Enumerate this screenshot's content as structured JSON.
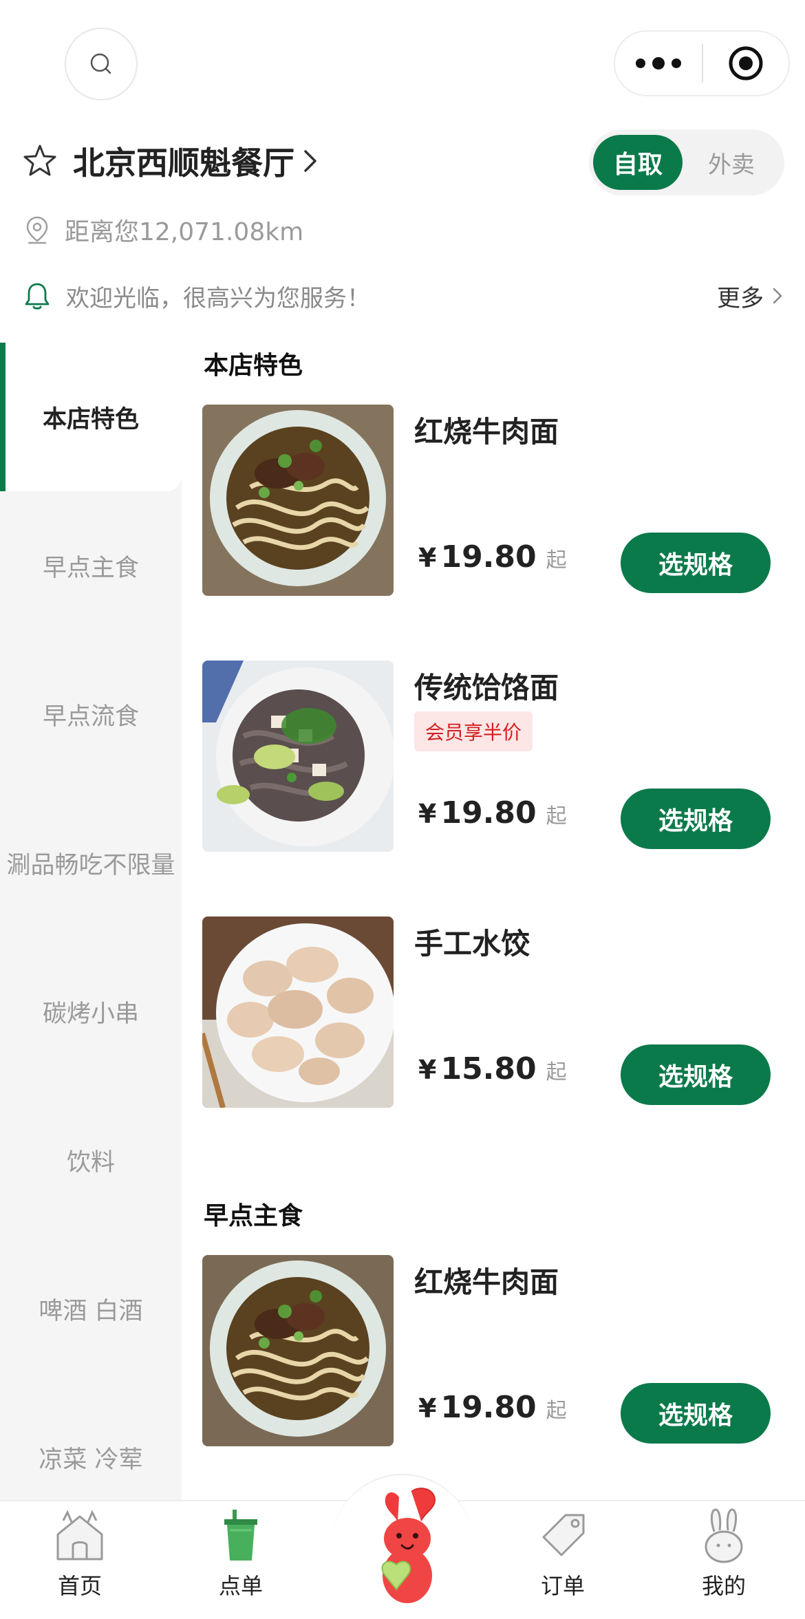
{
  "topbar": {
    "search_icon": "search-icon",
    "more_icon": "more-dots-icon",
    "close_icon": "record-target-icon"
  },
  "store": {
    "name": "北京西顺魁餐厅",
    "distance": "距离您12,071.08km",
    "notice": "欢迎光临，很高兴为您服务！",
    "more_label": "更多"
  },
  "mode_toggle": {
    "active": "自取",
    "inactive": "外卖"
  },
  "sidebar": {
    "items": [
      {
        "label": "本店特色",
        "active": true
      },
      {
        "label": "早点主食"
      },
      {
        "label": "早点流食"
      },
      {
        "label": "涮品畅吃不限量"
      },
      {
        "label": "碳烤小串"
      },
      {
        "label": "饮料"
      },
      {
        "label": "啤酒 白酒"
      },
      {
        "label": "凉菜 冷荤"
      }
    ]
  },
  "sections": [
    {
      "title": "本店特色",
      "dishes": [
        {
          "name": "红烧牛肉面",
          "currency": "¥",
          "price": "19.80",
          "suffix": "起",
          "button": "选规格"
        },
        {
          "name": "传统饸饹面",
          "badge": "会员享半价",
          "currency": "¥",
          "price": "19.80",
          "suffix": "起",
          "button": "选规格"
        },
        {
          "name": "手工水饺",
          "currency": "¥",
          "price": "15.80",
          "suffix": "起",
          "button": "选规格"
        }
      ]
    },
    {
      "title": "早点主食",
      "dishes": [
        {
          "name": "红烧牛肉面",
          "currency": "¥",
          "price": "19.80",
          "suffix": "起",
          "button": "选规格"
        }
      ]
    }
  ],
  "tabbar": {
    "items": [
      {
        "label": "首页",
        "icon": "home-icon"
      },
      {
        "label": "点单",
        "icon": "cup-icon"
      },
      {
        "label": "",
        "icon": "mascot-icon"
      },
      {
        "label": "订单",
        "icon": "tag-icon"
      },
      {
        "label": "我的",
        "icon": "rabbit-icon"
      }
    ]
  },
  "colors": {
    "accent": "#0b7a4b",
    "badge_bg": "#fde6e6",
    "badge_text": "#d32020",
    "sidebar_bg": "#f5f5f5"
  }
}
